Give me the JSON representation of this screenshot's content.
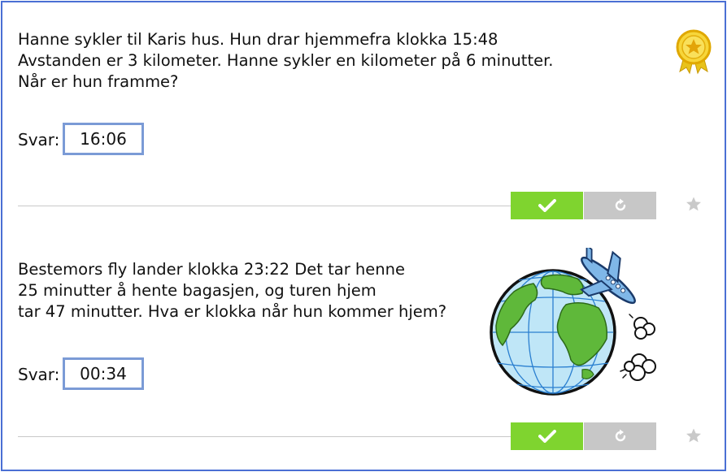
{
  "question1": {
    "lines": [
      "Hanne sykler til Karis hus. Hun drar hjemmefra klokka 15:48",
      "Avstanden er 3 kilometer. Hanne sykler en kilometer på 6 minutter.",
      "Når er hun framme?"
    ],
    "answer_label": "Svar:",
    "answer_value": "16:06",
    "badge_icon": "gold-medal-icon"
  },
  "question2": {
    "lines": [
      "Bestemors fly lander klokka 23:22 Det tar henne",
      "25 minutter å hente bagasjen, og turen hjem",
      "tar 47 minutter. Hva er klokka når hun kommer hjem?"
    ],
    "answer_label": "Svar:",
    "answer_value": "00:34",
    "illustration_icon": "globe-with-airplane-illustration"
  },
  "controls": {
    "check_icon": "checkmark-icon",
    "reset_icon": "reset-icon",
    "favorite_icon": "star-icon"
  },
  "colors": {
    "frame_border": "#4a6fd4",
    "answer_border": "#7b9bd6",
    "check_button": "#7fd42f",
    "reset_button": "#c7c7c7",
    "star": "#c9c9c9"
  }
}
